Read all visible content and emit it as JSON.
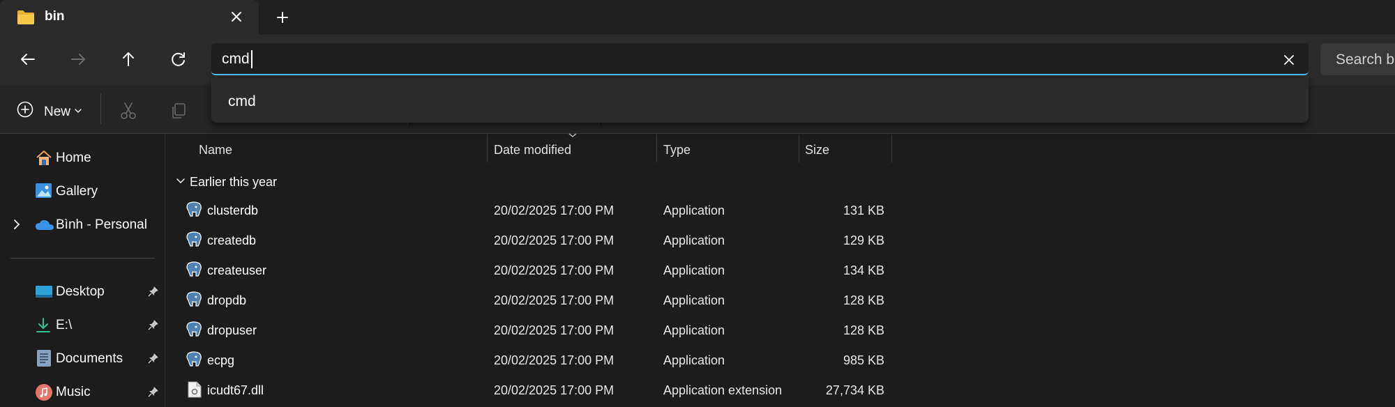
{
  "window": {
    "tab_title": "bin",
    "new_tab_symbol": "+"
  },
  "address_bar": {
    "value": "cmd",
    "suggestion": "cmd",
    "search_label": "Search bin"
  },
  "command_bar": {
    "new_label": "New"
  },
  "nav_pane": {
    "top_items": [
      {
        "label": "Home",
        "icon": "home-icon"
      },
      {
        "label": "Gallery",
        "icon": "gallery-icon"
      },
      {
        "label": "Bình - Personal",
        "icon": "onedrive-icon"
      }
    ],
    "quick_access": [
      {
        "label": "Desktop",
        "icon": "desktop-icon"
      },
      {
        "label": "E:\\",
        "icon": "download-icon"
      },
      {
        "label": "Documents",
        "icon": "documents-icon"
      },
      {
        "label": "Music",
        "icon": "music-icon"
      }
    ]
  },
  "file_list": {
    "columns": {
      "name": "Name",
      "date": "Date modified",
      "type": "Type",
      "size": "Size"
    },
    "group": "Earlier this year",
    "rows": [
      {
        "name": "clusterdb",
        "date": "20/02/2025 17:00 PM",
        "type": "Application",
        "size": "131 KB",
        "icon": "postgres-elephant-icon"
      },
      {
        "name": "createdb",
        "date": "20/02/2025 17:00 PM",
        "type": "Application",
        "size": "129 KB",
        "icon": "postgres-elephant-icon"
      },
      {
        "name": "createuser",
        "date": "20/02/2025 17:00 PM",
        "type": "Application",
        "size": "134 KB",
        "icon": "postgres-elephant-icon"
      },
      {
        "name": "dropdb",
        "date": "20/02/2025 17:00 PM",
        "type": "Application",
        "size": "128 KB",
        "icon": "postgres-elephant-icon"
      },
      {
        "name": "dropuser",
        "date": "20/02/2025 17:00 PM",
        "type": "Application",
        "size": "128 KB",
        "icon": "postgres-elephant-icon"
      },
      {
        "name": "ecpg",
        "date": "20/02/2025 17:00 PM",
        "type": "Application",
        "size": "985 KB",
        "icon": "postgres-elephant-icon"
      },
      {
        "name": "icudt67.dll",
        "date": "20/02/2025 17:00 PM",
        "type": "Application extension",
        "size": "27,734 KB",
        "icon": "dll-file-icon"
      }
    ]
  },
  "colors": {
    "accent": "#4cc2ff",
    "folder": "#f3c13a",
    "background": "#1c1c1c"
  }
}
